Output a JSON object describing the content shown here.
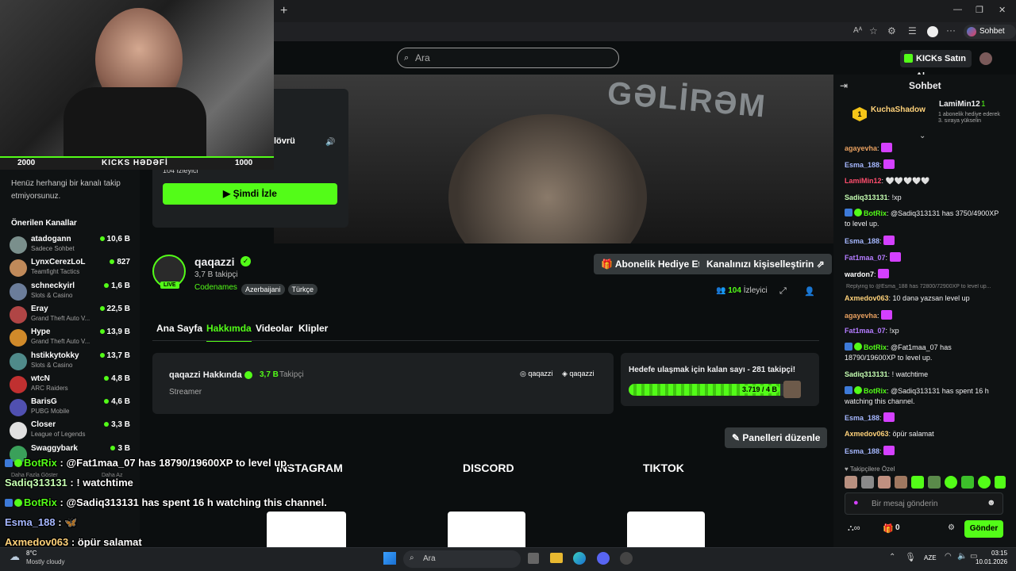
{
  "browser": {
    "new_tab": "+",
    "read_aloud": "Aᴬ",
    "chat_button": "Sohbet et",
    "min": "—",
    "max": "❐",
    "close": "✕"
  },
  "topbar": {
    "search_placeholder": "Ara",
    "kicks_buy": "KICKs Satın Al"
  },
  "overlay": {
    "goal_left": "2000",
    "goal_label": "KICKS HƏDƏFİ",
    "goal_right": "1000"
  },
  "mini_player": {
    "title_fragment": "lövrü",
    "viewers_fragment": "104 İzleyici",
    "watch_label": "Şimdi İzle"
  },
  "sidebar": {
    "empty_text": "Henüz herhangi bir kanalı takip etmiyorsunuz.",
    "recommended_title": "Önerilen Kanallar",
    "show_more": "Daha Fazla Göster",
    "show_less": "Daha Az",
    "channels": [
      {
        "name": "atadogann",
        "category": "Sadece Sohbet",
        "viewers": "10,6 B",
        "color": "#7a8f8c"
      },
      {
        "name": "LynxCerezLoL",
        "category": "Teamfight Tactics",
        "viewers": "827",
        "color": "#c08a5a"
      },
      {
        "name": "schneckyirl",
        "category": "Slots & Casino",
        "viewers": "1,6 B",
        "color": "#6b7d9a"
      },
      {
        "name": "Eray",
        "category": "Grand Theft Auto V...",
        "viewers": "22,5 B",
        "color": "#b04545"
      },
      {
        "name": "Hype",
        "category": "Grand Theft Auto V...",
        "viewers": "13,9 B",
        "color": "#d08a2a"
      },
      {
        "name": "hstikkytokky",
        "category": "Slots & Casino",
        "viewers": "13,7 B",
        "color": "#4f8a8a"
      },
      {
        "name": "wtcN",
        "category": "ARC Raiders",
        "viewers": "4,8 B",
        "color": "#c03030"
      },
      {
        "name": "BarisG",
        "category": "PUBG Mobile",
        "viewers": "4,6 B",
        "color": "#5050b0"
      },
      {
        "name": "Closer",
        "category": "League of Legends",
        "viewers": "3,3 B",
        "color": "#e0e0e0"
      },
      {
        "name": "Swaggybark",
        "category": "",
        "viewers": "3 B",
        "color": "#3aa05a"
      }
    ]
  },
  "channel": {
    "name": "qaqazzi",
    "followers": "3,7 B takipçi",
    "live": "LIVE",
    "category": "Codenames",
    "tags": [
      "Azerbaijani",
      "Türkçe"
    ],
    "gift_btn": "Abonelik Hediye Et",
    "customize_btn": "Kanalınızı kişiselleştirin",
    "viewer_count": "104",
    "viewer_label": "İzleyici"
  },
  "tabs": [
    "Ana Sayfa",
    "Hakkımda",
    "Videolar",
    "Klipler"
  ],
  "about": {
    "title": "qaqazzi Hakkında",
    "follower_count": "3,7 B",
    "follower_label": "Takipçi",
    "role": "Streamer",
    "instagram": "qaqazzi",
    "discord": "qaqazzi"
  },
  "goal": {
    "text": "Hedefe ulaşmak için kalan sayı - 281 takipçi!",
    "progress_label": "3.719 / 4 B",
    "progress": 0.93
  },
  "edit_panels": "Panelleri düzenle",
  "panels": [
    "INSTAGRAM",
    "DISCORD",
    "TIKTOK"
  ],
  "chat": {
    "title": "Sohbet",
    "top1": "KuchaShadow",
    "top1_rank": "1",
    "top2": "LamiMin12",
    "top2_rank": "1",
    "gift_note": "1 abonelik hediye ederek 3. sıraya yükselin",
    "followers_only": "Takipçilere Özel",
    "input_placeholder": "Bir mesaj gönderin",
    "points": "0",
    "send": "Gönder",
    "messages": [
      {
        "user": "agayevha",
        "color": "#e8a060",
        "text": ""
      },
      {
        "user": "Esma_188",
        "color": "#a6b8ff",
        "text": ""
      },
      {
        "user": "LamiMin12",
        "color": "#ff4d6d",
        "text": "🤍🤍🤍🤍🤍"
      },
      {
        "user": "Sadiq313131",
        "color": "#c6ffb3",
        "text": "!xp"
      },
      {
        "user": "BotRix",
        "color": "#53fc18",
        "text": "@Sadiq313131 has 3750/4900XP to level up."
      },
      {
        "user": "Esma_188",
        "color": "#a6b8ff",
        "text": ""
      },
      {
        "user": "Fat1maa_07",
        "color": "#b47cff",
        "text": ""
      },
      {
        "user": "wardon7",
        "color": "#ffffff",
        "text": ""
      },
      {
        "user": "Axmedov063",
        "color": "#ffd27a",
        "text": "10 dənə yazsan level up"
      },
      {
        "user": "agayevha",
        "color": "#e8a060",
        "text": ""
      },
      {
        "user": "Fat1maa_07",
        "color": "#b47cff",
        "text": "!xp"
      },
      {
        "user": "BotRix",
        "color": "#53fc18",
        "text": "@Fat1maa_07 has 18790/19600XP to level up."
      },
      {
        "user": "Sadiq313131",
        "color": "#c6ffb3",
        "text": "! watchtime"
      },
      {
        "user": "BotRix",
        "color": "#53fc18",
        "text": "@Sadiq313131 has spent 16 h watching this channel."
      },
      {
        "user": "Esma_188",
        "color": "#a6b8ff",
        "text": ""
      },
      {
        "user": "Axmedov063",
        "color": "#ffd27a",
        "text": "öpür salamat"
      },
      {
        "user": "Esma_188",
        "color": "#a6b8ff",
        "text": ""
      }
    ],
    "reply_note": "Replying to @Esma_188 has 72800/72900XP to level up..."
  },
  "overlay_chat": [
    {
      "user": "BotRix",
      "text": "@Fat1maa_07 has 18790/19600XP to level up."
    },
    {
      "user": "Sadiq313131",
      "text": "! watchtime"
    },
    {
      "user": "BotRix",
      "text": "@Sadiq313131 has spent 16 h watching this channel."
    },
    {
      "user": "Esma_188",
      "text": ""
    },
    {
      "user": "Axmedov063",
      "text": "öpür salamat"
    }
  ],
  "taskbar": {
    "temp": "8°C",
    "weather": "Mostly cloudy",
    "search": "Ara",
    "lang": "AZE",
    "time": "03:15",
    "date": "10.01.2026"
  },
  "colors": {
    "accent": "#53fc18",
    "bg": "#0b0e0f",
    "panel": "#1d2022"
  }
}
